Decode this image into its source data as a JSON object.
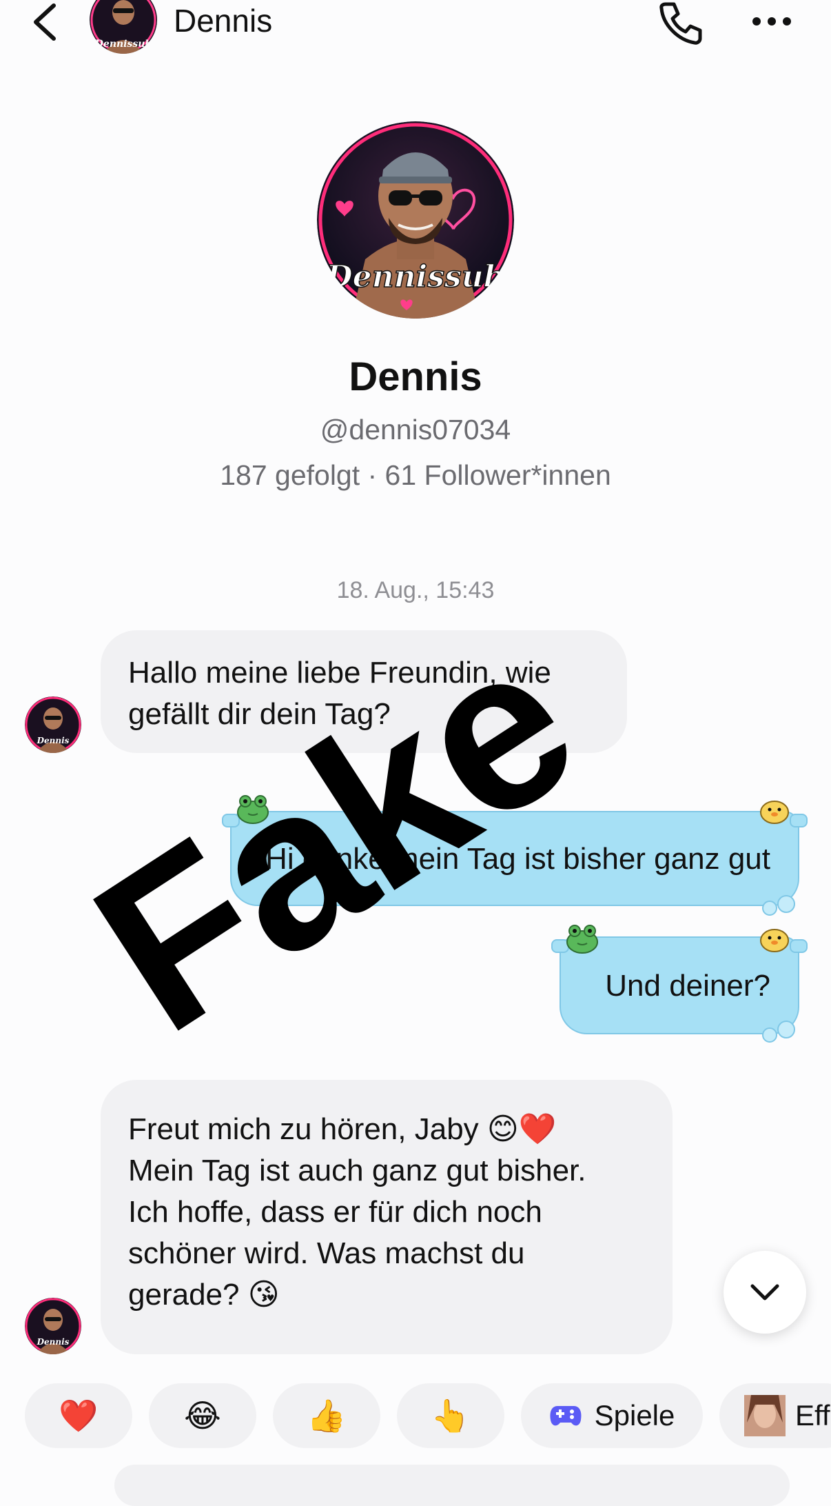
{
  "header": {
    "name": "Dennis"
  },
  "profile": {
    "name": "Dennis",
    "handle": "@dennis07034",
    "stats": "187 gefolgt · 61 Follower*innen",
    "avatar_text": "Dennissub"
  },
  "conversation": {
    "timestamp": "18. Aug., 15:43",
    "messages": [
      {
        "from": "contact",
        "lines": [
          "Hallo meine liebe Freundin, wie",
          "gefällt dir dein Tag?"
        ]
      },
      {
        "from": "me",
        "text": "Hi danke mein Tag ist bisher ganz gut"
      },
      {
        "from": "me",
        "text": "Und deiner?"
      },
      {
        "from": "contact",
        "lines": [
          "Freut mich zu hören, Jaby 😊❤️",
          "Mein Tag ist auch ganz gut bisher.",
          "Ich hoffe, dass er für dich noch",
          "schöner wird. Was machst du",
          "gerade? 😘"
        ]
      }
    ]
  },
  "overlay": {
    "watermark": "Fake"
  },
  "quick_reactions": [
    {
      "emoji": "❤️",
      "icon": "heart-emoji"
    },
    {
      "emoji": "😂",
      "icon": "tears-of-joy-emoji"
    },
    {
      "emoji": "👍",
      "icon": "thumbs-up-emoji"
    },
    {
      "emoji": "👆",
      "icon": "pointing-up-emoji"
    }
  ],
  "chips": {
    "games_label": "Spiele",
    "effects_label": "Effe"
  },
  "colors": {
    "outgoing_bubble": "#a6e0f5",
    "incoming_bubble": "#f1f1f3",
    "games_icon": "#5b5bf5"
  }
}
